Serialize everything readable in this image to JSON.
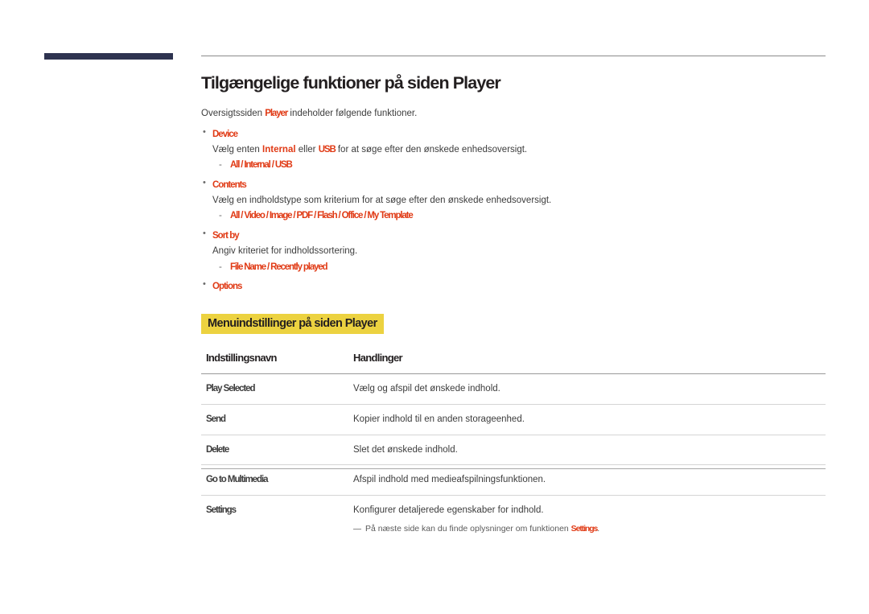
{
  "document": {
    "title": "Tilgængelige funktioner på siden Player",
    "intro_before": "Oversigtssiden ",
    "intro_accent": "Player",
    "intro_after": " indeholder følgende funktioner.",
    "features": [
      {
        "name": "Device",
        "description_parts": {
          "before": "Vælg enten ",
          "accent1": "Internal",
          "middle": " eller ",
          "accent2": "USB",
          "after": " for at søge efter den ønskede enhedsoversigt."
        },
        "options": "All / Internal / USB"
      },
      {
        "name": "Contents",
        "description_parts": {
          "before": "Vælg en indholdstype som kriterium for at søge efter den ønskede enhedsoversigt.",
          "accent1": "",
          "middle": "",
          "accent2": "",
          "after": ""
        },
        "options": "All / Video / Image / PDF / Flash / Office / My Template"
      },
      {
        "name": "Sort by",
        "description_parts": {
          "before": "Angiv kriteriet for indholdssortering.",
          "accent1": "",
          "middle": "",
          "accent2": "",
          "after": ""
        },
        "options": "File Name / Recently played"
      },
      {
        "name": "Options",
        "description_parts": {
          "before": "",
          "accent1": "",
          "middle": "",
          "accent2": "",
          "after": ""
        },
        "options": ""
      }
    ],
    "section_heading": "Menuindstillinger på siden Player",
    "table": {
      "headers": {
        "name": "Indstillingsnavn",
        "actions": "Handlinger"
      },
      "rows": [
        {
          "name": "Play Selected",
          "action": "Vælg og afspil det ønskede indhold.",
          "note": null
        },
        {
          "name": "Send",
          "action": "Kopier indhold til en anden storageenhed.",
          "note": null
        },
        {
          "name": "Delete",
          "action": "Slet det ønskede indhold.",
          "note": null
        },
        {
          "name": "Go to Multimedia",
          "action": "Afspil indhold med medieafspilningsfunktionen.",
          "note": null
        },
        {
          "name": "Settings",
          "action": "Konfigurer detaljerede egenskaber for indhold.",
          "note": {
            "before": "På næste side kan du finde oplysninger om funktionen ",
            "accent": "Settings",
            "after": "."
          }
        }
      ]
    }
  },
  "colors": {
    "accent": "#e03a15",
    "highlight": "#ecd240",
    "corner_bar": "#2e3350",
    "text": "#3c3c3c",
    "heading": "#231f20"
  }
}
